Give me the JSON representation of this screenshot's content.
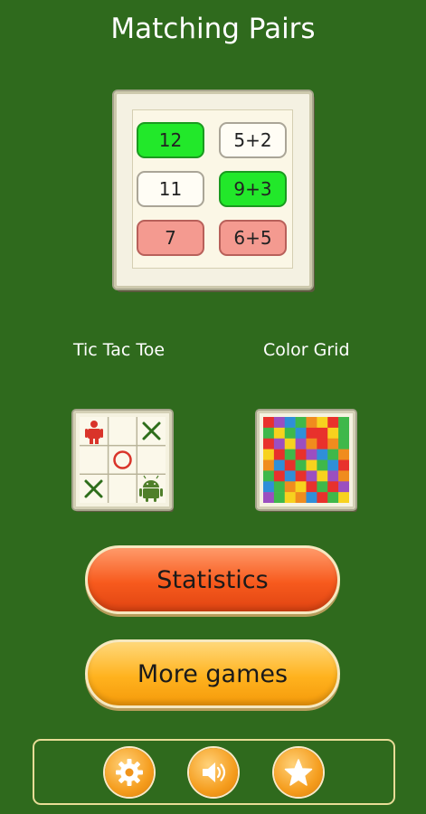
{
  "app": {
    "title": "Matching Pairs"
  },
  "preview": {
    "tiles": [
      {
        "label": "12",
        "state": "matched"
      },
      {
        "label": "5+2",
        "state": "normal"
      },
      {
        "label": "11",
        "state": "normal"
      },
      {
        "label": "9+3",
        "state": "matched"
      },
      {
        "label": "7",
        "state": "wrong"
      },
      {
        "label": "6+5",
        "state": "wrong"
      }
    ]
  },
  "games": [
    {
      "label": "Tic Tac Toe",
      "icon": "tic-tac-toe-icon"
    },
    {
      "label": "Color Grid",
      "icon": "color-grid-icon"
    }
  ],
  "buttons": {
    "statistics": "Statistics",
    "more_games": "More games"
  },
  "bottom_bar": [
    {
      "icon": "gear-icon"
    },
    {
      "icon": "speaker-icon"
    },
    {
      "icon": "star-icon"
    }
  ],
  "colors": {
    "background": "#2f6a1d",
    "matched": "#22e82a",
    "wrong": "#f49a90",
    "statistics_button": "#f75a1d",
    "more_games_button": "#ffb21e"
  }
}
